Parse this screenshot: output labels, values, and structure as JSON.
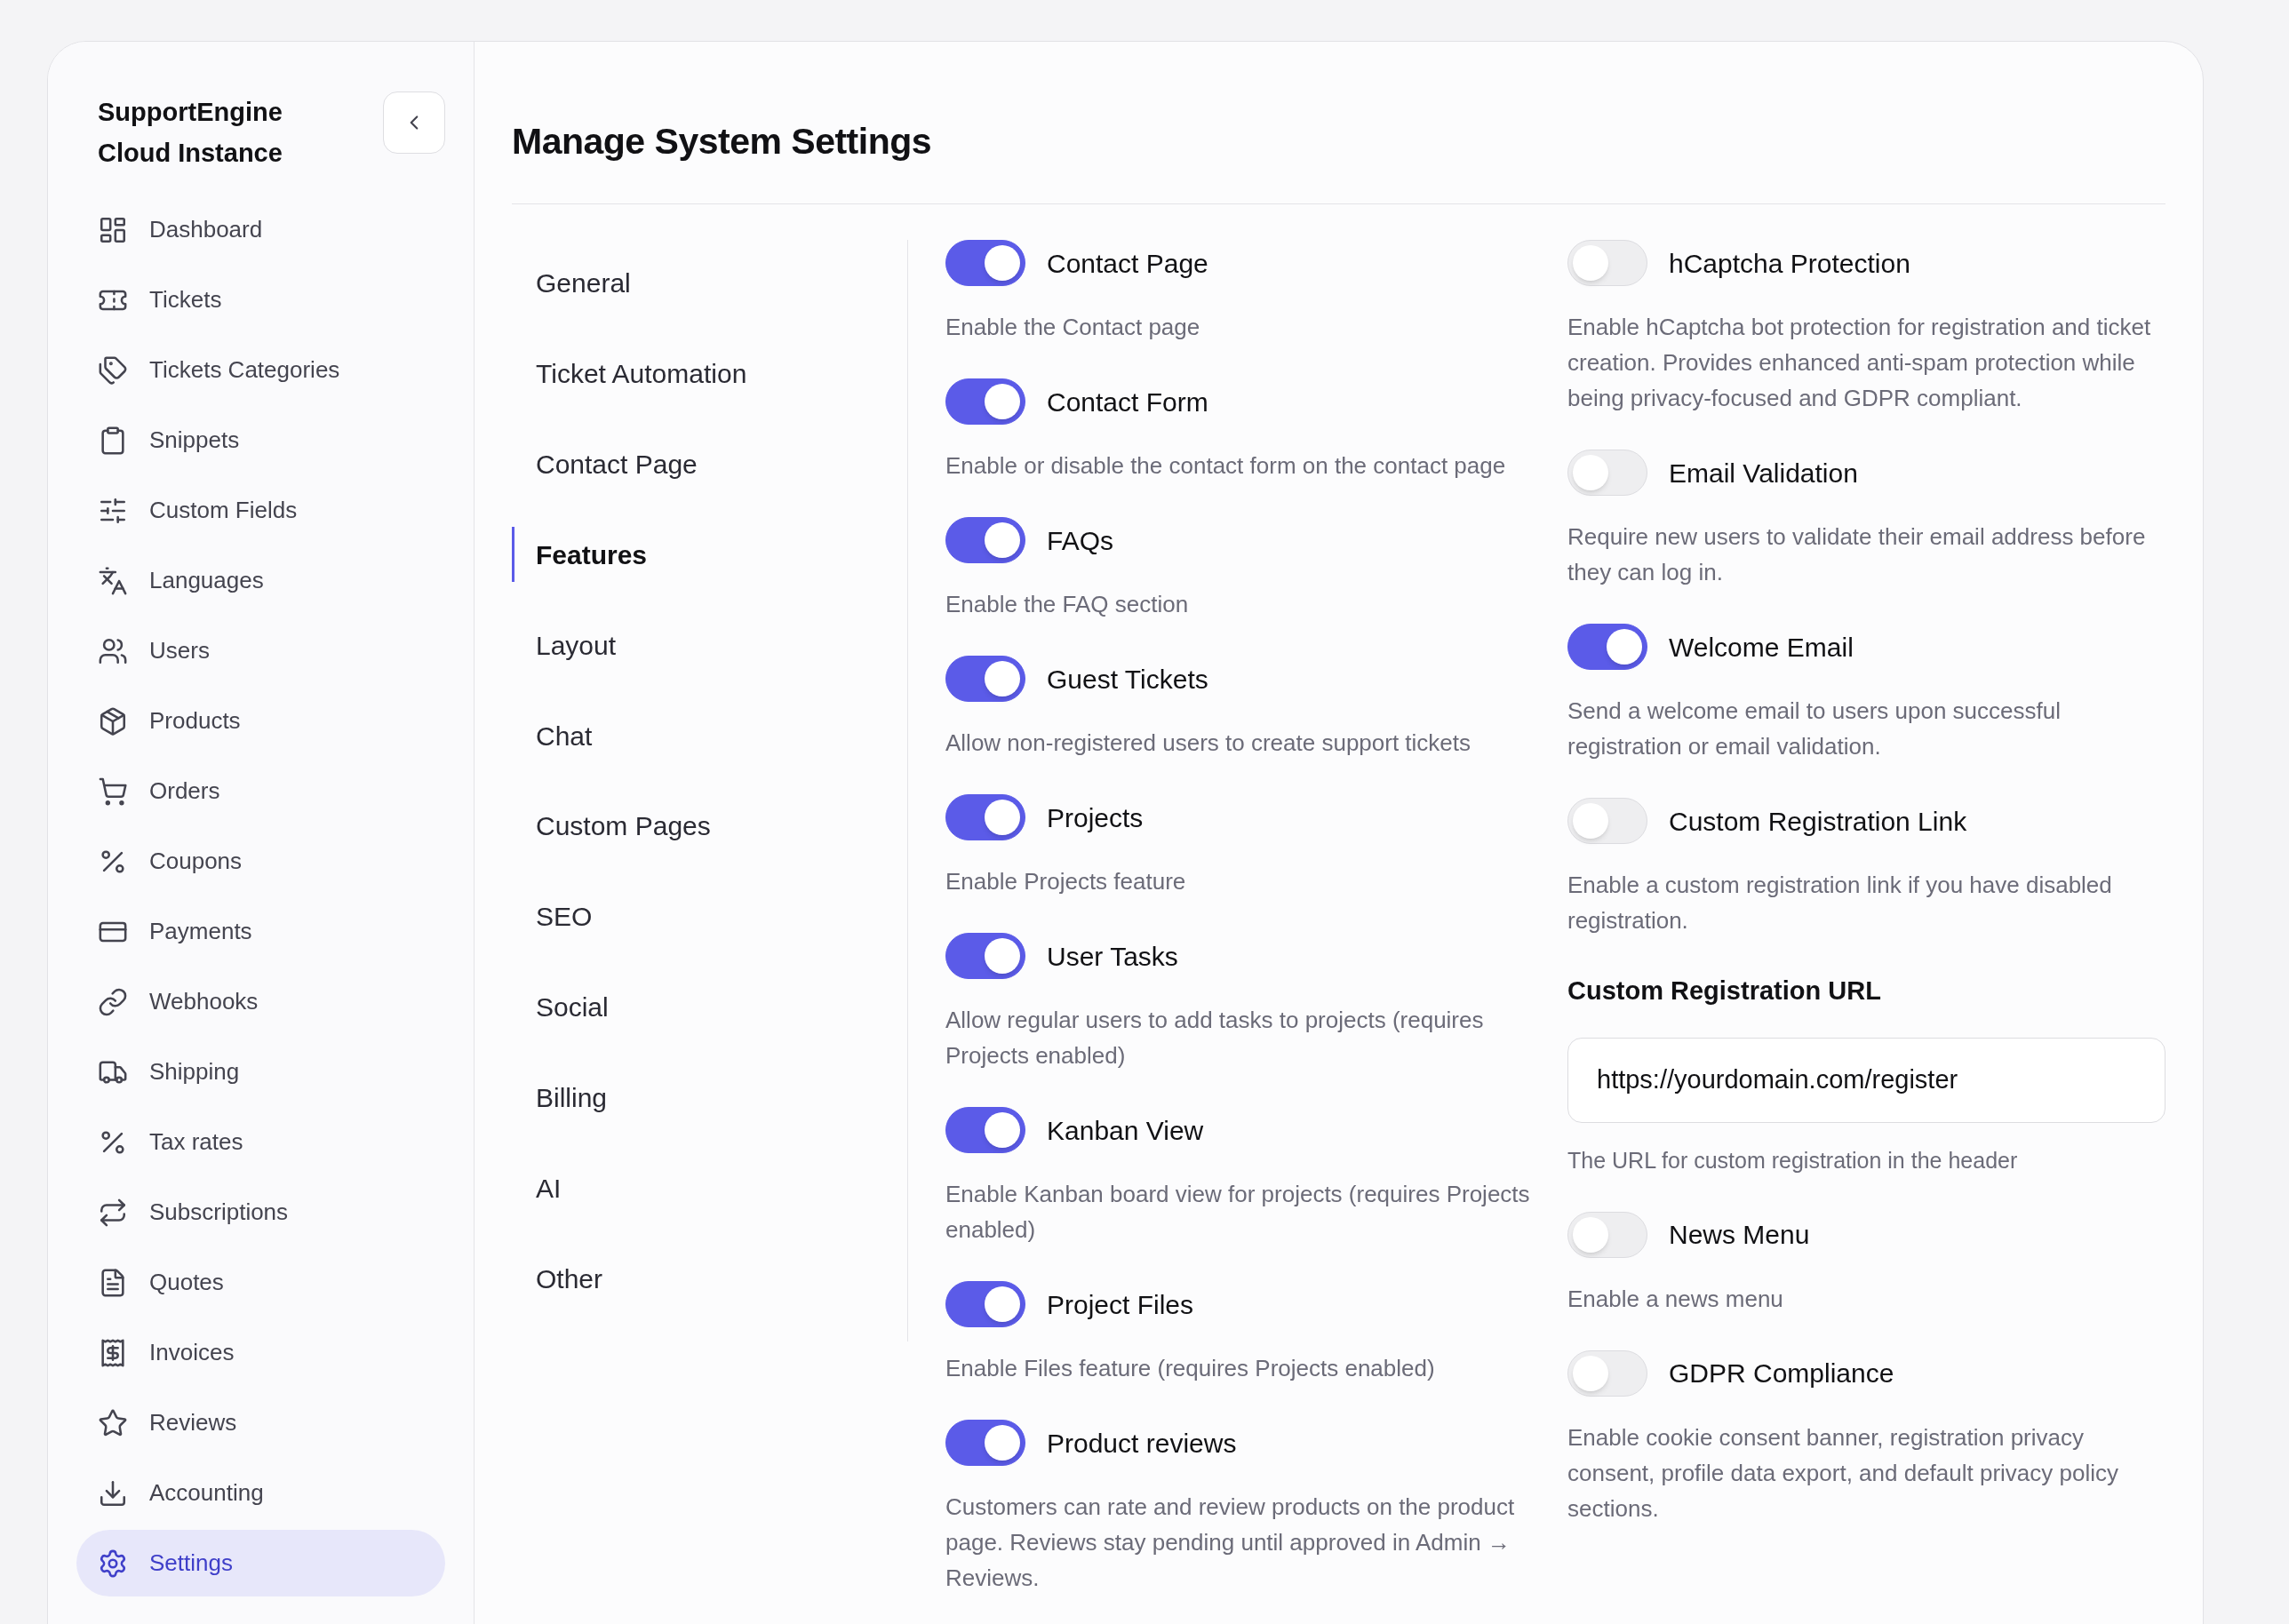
{
  "sidebar": {
    "title": "SupportEngine Cloud Instance",
    "items": [
      {
        "label": "Dashboard",
        "selected": false
      },
      {
        "label": "Tickets",
        "selected": false
      },
      {
        "label": "Tickets Categories",
        "selected": false
      },
      {
        "label": "Snippets",
        "selected": false
      },
      {
        "label": "Custom Fields",
        "selected": false
      },
      {
        "label": "Languages",
        "selected": false
      },
      {
        "label": "Users",
        "selected": false
      },
      {
        "label": "Products",
        "selected": false
      },
      {
        "label": "Orders",
        "selected": false
      },
      {
        "label": "Coupons",
        "selected": false
      },
      {
        "label": "Payments",
        "selected": false
      },
      {
        "label": "Webhooks",
        "selected": false
      },
      {
        "label": "Shipping",
        "selected": false
      },
      {
        "label": "Tax rates",
        "selected": false
      },
      {
        "label": "Subscriptions",
        "selected": false
      },
      {
        "label": "Quotes",
        "selected": false
      },
      {
        "label": "Invoices",
        "selected": false
      },
      {
        "label": "Reviews",
        "selected": false
      },
      {
        "label": "Accounting",
        "selected": false
      },
      {
        "label": "Settings",
        "selected": true
      }
    ]
  },
  "page": {
    "title": "Manage System Settings"
  },
  "sections": [
    {
      "label": "General",
      "selected": false
    },
    {
      "label": "Ticket Automation",
      "selected": false
    },
    {
      "label": "Contact Page",
      "selected": false
    },
    {
      "label": "Features",
      "selected": true
    },
    {
      "label": "Layout",
      "selected": false
    },
    {
      "label": "Chat",
      "selected": false
    },
    {
      "label": "Custom Pages",
      "selected": false
    },
    {
      "label": "SEO",
      "selected": false
    },
    {
      "label": "Social",
      "selected": false
    },
    {
      "label": "Billing",
      "selected": false
    },
    {
      "label": "AI",
      "selected": false
    },
    {
      "label": "Other",
      "selected": false
    }
  ],
  "features_left": [
    {
      "kind": "toggle",
      "label": "Contact Page",
      "on": true,
      "description": "Enable the Contact page"
    },
    {
      "kind": "toggle",
      "label": "Contact Form",
      "on": true,
      "description": "Enable or disable the contact form on the contact page"
    },
    {
      "kind": "toggle",
      "label": "FAQs",
      "on": true,
      "description": "Enable the FAQ section"
    },
    {
      "kind": "toggle",
      "label": "Guest Tickets",
      "on": true,
      "description": "Allow non-registered users to create support tickets"
    },
    {
      "kind": "toggle",
      "label": "Projects",
      "on": true,
      "description": "Enable Projects feature"
    },
    {
      "kind": "toggle",
      "label": "User Tasks",
      "on": true,
      "description": "Allow regular users to add tasks to projects (requires Projects enabled)"
    },
    {
      "kind": "toggle",
      "label": "Kanban View",
      "on": true,
      "description": "Enable Kanban board view for projects (requires Projects enabled)"
    },
    {
      "kind": "toggle",
      "label": "Project Files",
      "on": true,
      "description": "Enable Files feature (requires Projects enabled)"
    },
    {
      "kind": "toggle",
      "label": "Product reviews",
      "on": true,
      "description": "Customers can rate and review products on the product page. Reviews stay pending until approved in Admin → Reviews."
    }
  ],
  "features_right": [
    {
      "kind": "toggle",
      "label": "hCaptcha Protection",
      "on": false,
      "description": "Enable hCaptcha bot protection for registration and ticket creation. Provides enhanced anti-spam protection while being privacy-focused and GDPR compliant."
    },
    {
      "kind": "toggle",
      "label": "Email Validation",
      "on": false,
      "description": "Require new users to validate their email address before they can log in."
    },
    {
      "kind": "toggle",
      "label": "Welcome Email",
      "on": true,
      "description": "Send a welcome email to users upon successful registration or email validation."
    },
    {
      "kind": "toggle",
      "label": "Custom Registration Link",
      "on": false,
      "description": "Enable a custom registration link if you have disabled registration."
    },
    {
      "kind": "field",
      "label": "Custom Registration URL",
      "value": "https://yourdomain.com/register",
      "description": "The URL for custom registration in the header"
    },
    {
      "kind": "toggle",
      "label": "News Menu",
      "on": false,
      "description": "Enable a news menu"
    },
    {
      "kind": "toggle",
      "label": "GDPR Compliance",
      "on": false,
      "description": "Enable cookie consent banner, registration privacy consent, profile data export, and default privacy policy sections."
    }
  ]
}
